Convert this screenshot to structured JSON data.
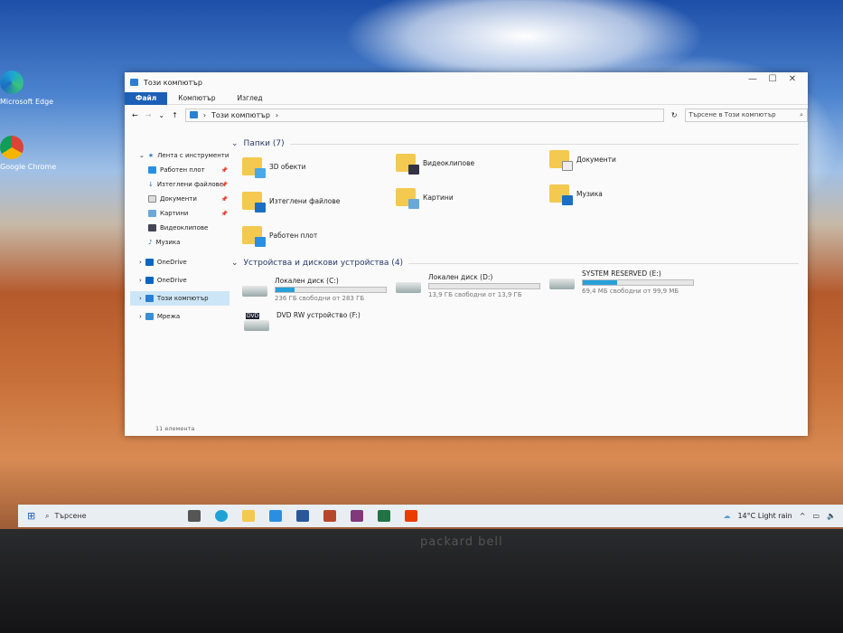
{
  "window": {
    "title": "Този компютър",
    "ribbon_tabs": [
      "Файл",
      "Компютър",
      "Изглед"
    ],
    "address": "Този компютър",
    "search_placeholder": "Търсене в Този компютър",
    "status": "11 елемента"
  },
  "sidebar": {
    "quick_access": "Лента с инструменти",
    "items": [
      "Работен плот",
      "Изтеглени файлове",
      "Документи",
      "Картини",
      "Видеоклипове",
      "Музика"
    ],
    "onedrive1": "OneDrive",
    "onedrive2": "OneDrive",
    "this_pc": "Този компютър",
    "network": "Мрежа"
  },
  "folders": {
    "header": "Папки (7)",
    "items": [
      "3D обекти",
      "Видеоклипове",
      "Документи",
      "Изтеглени файлове",
      "Картини",
      "Музика",
      "Работен плот"
    ]
  },
  "devices": {
    "header": "Устройства и дискови устройства (4)",
    "drives": [
      {
        "name": "Локален диск (C:)",
        "info": "236 ГБ свободни от 283 ГБ",
        "used_fraction": 0.17
      },
      {
        "name": "Локален диск (D:)",
        "info": "13,9 ГБ свободни от 13,9 ГБ",
        "used_fraction": 0.0
      },
      {
        "name": "SYSTEM RESERVED (E:)",
        "info": "69,4 МБ свободни от 99,9 МБ",
        "used_fraction": 0.31
      }
    ],
    "dvd": "DVD RW устройство (F:)",
    "dvd_badge": "DVD"
  },
  "taskbar": {
    "search": "Търсене",
    "weather": "14°C  Light rain"
  },
  "desktop": {
    "icons": [
      "Microsoft Edge",
      "Google Chrome"
    ]
  },
  "brand": "packard bell"
}
